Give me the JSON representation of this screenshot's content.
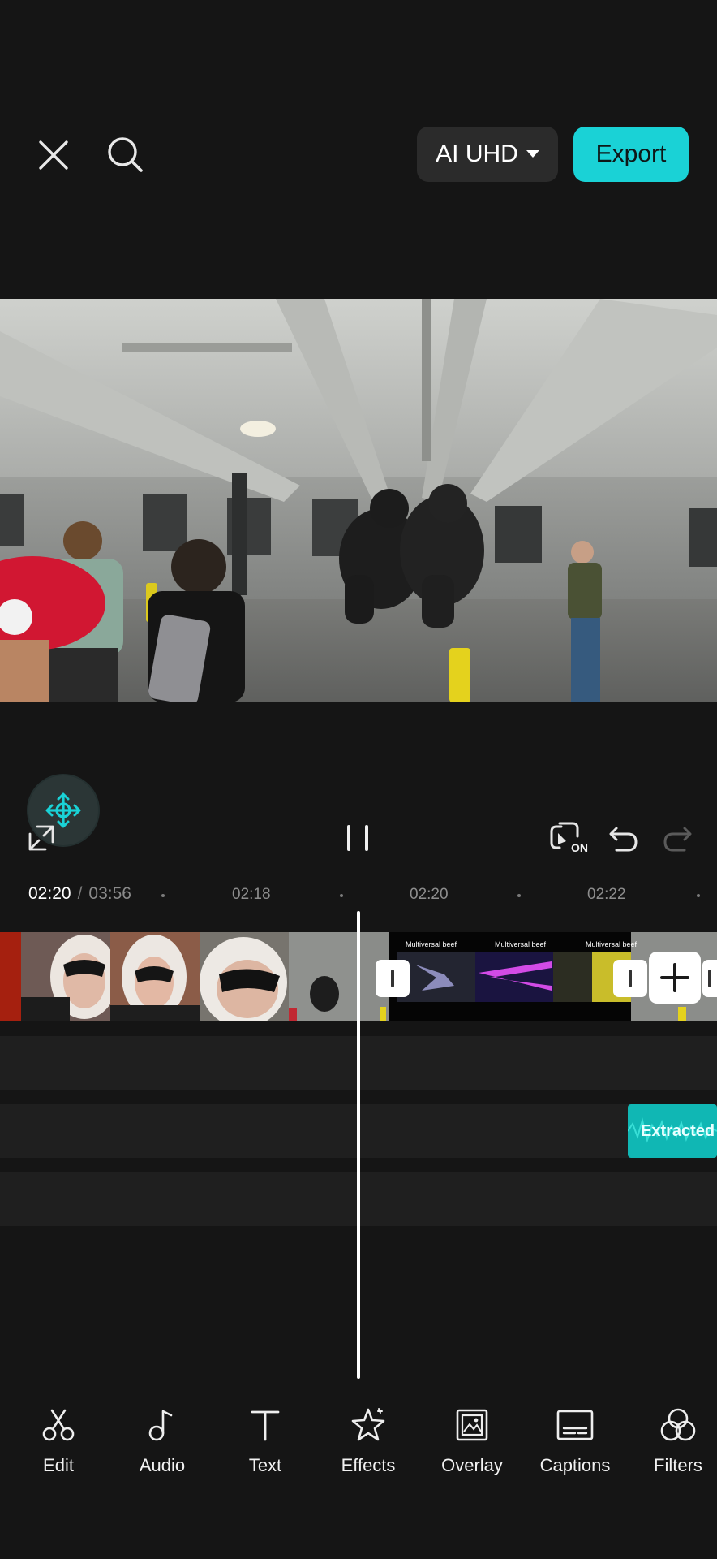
{
  "header": {
    "close_icon": "close-icon",
    "search_icon": "search-icon",
    "quality_label": "AI UHD",
    "export_label": "Export",
    "accent_color": "#1ad2d6"
  },
  "player": {
    "current_time": "02:20",
    "separator": "/",
    "total_time": "03:56",
    "pause_icon": "pause-icon",
    "fullscreen_icon": "fullscreen-icon",
    "keyframe_icon": "keyframe-icon",
    "auto_sync_icon": "auto-sync-on-icon",
    "auto_sync_badge": "ON",
    "undo_icon": "undo-icon",
    "redo_icon": "redo-icon"
  },
  "ruler": {
    "ticks": [
      "02:18",
      "02:20",
      "02:22"
    ]
  },
  "timeline": {
    "clip_captions": [
      "Multiversal beef",
      "Multiversal beef",
      "Multiversal beef"
    ],
    "audio_clip_label": "Extracted",
    "audio_clip_color": "#10b7b4"
  },
  "toolbar": {
    "items": [
      {
        "label": "Edit",
        "icon": "scissors-icon"
      },
      {
        "label": "Audio",
        "icon": "music-note-icon"
      },
      {
        "label": "Text",
        "icon": "text-icon"
      },
      {
        "label": "Effects",
        "icon": "effects-star-icon"
      },
      {
        "label": "Overlay",
        "icon": "overlay-icon"
      },
      {
        "label": "Captions",
        "icon": "captions-icon"
      },
      {
        "label": "Filters",
        "icon": "filters-icon"
      }
    ]
  }
}
